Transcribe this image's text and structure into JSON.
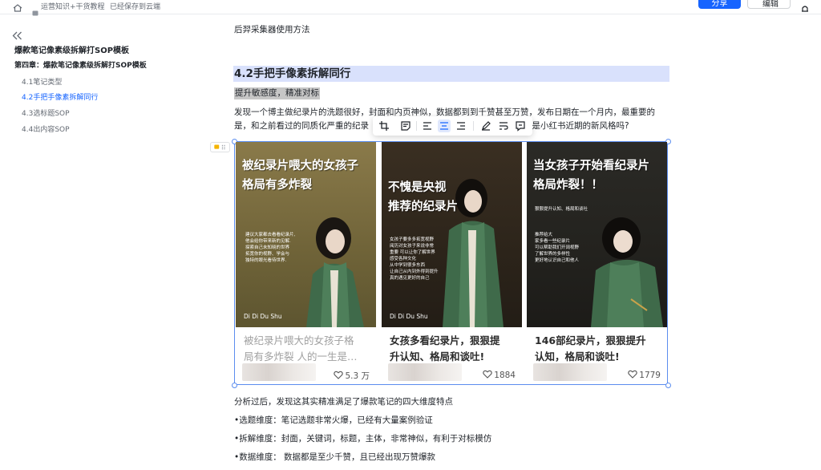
{
  "header": {
    "breadcrumb_space": "运营知识+干货教程",
    "save_status": "已经保存到云端",
    "share_label": "分享",
    "edit_label": "编辑"
  },
  "outline": {
    "title": "爆款笔记像素级拆解打SOP模板",
    "chapter": "第四章：爆款笔记像素级拆解打SOP模板",
    "items": [
      {
        "label": "4.1笔记类型",
        "active": false
      },
      {
        "label": "4.2手把手像素拆解同行",
        "active": true
      },
      {
        "label": "4.3选标题SOP",
        "active": false
      },
      {
        "label": "4.4出内容SOP",
        "active": false
      }
    ]
  },
  "doc": {
    "top_line": "后羿采集器使用方法",
    "heading": "4.2手把手像素拆解同行",
    "highlight": "提升敏感度，精准对标",
    "para_line1": "发现一个博主做纪录片的洗题很好，封面和内页神似，数据都到到千赞甚至万赞，发布日期在一个月内，最重要的",
    "para_line2_left": "是，和之前看过的同质化严重的纪录",
    "para_line2_right": "这是小红书近期的新风格吗?",
    "analysis": "分析过后，发现这其实精准满足了爆款笔记的四大维度特点",
    "bullets": [
      "•选题维度：笔记选题非常火爆，已经有大量案例验证",
      "•拆解维度：封面，关键词，标题，主体，非常神似，有利于对标模仿",
      "•数据维度： 数据都是至少千赞，且已经出现万赞爆款"
    ]
  },
  "cards": [
    {
      "cover_title": "被纪录片喂大的女孩子\n格局有多炸裂",
      "cover_body": "建议大家都去看看纪录片,\n他会给你带来新的见解.\n探索自己未知晓的世界\n拓宽你的视野、学会与\n独特的眼光看待世界.",
      "signature": "Di Di Du Shu",
      "caption": "被纪录片喂大的女孩子格\n局有多炸裂 人的一生是…",
      "likes": "5.3 万"
    },
    {
      "cover_title": "不愧是央视\n推荐的纪录片",
      "cover_body": "女孩子要多多拓宽视野\n阅历对女孩子来说非常\n重要 可以让你了解世界\n感受各种文化\n从中学到很多东西\n让自己从内到外得到提升\n真的遇见更好的自己",
      "signature": "Di Di Du Shu",
      "caption": "女孩多看纪录片，狠狠提\n升认知、格局和谈吐!",
      "likes": "1884"
    },
    {
      "cover_title": "当女孩子开始看纪录片\n格局炸裂！！",
      "cover_body": "狠狠提升认知、格局和谈吐\n\n\n\n推荐给大\n家多看一些纪录片\n可以帮助我们开阔视野\n了解世界的多样性\n更好地认识自己和他人",
      "signature": "",
      "caption": "146部纪录片，狠狠提升\n认知，格局和谈吐!",
      "likes": "1779"
    }
  ],
  "colors": {
    "accent": "#1664ff",
    "heading_bg": "#d9e1fc",
    "highlight_bg": "#c6c6c6",
    "selection": "#5b8def"
  }
}
